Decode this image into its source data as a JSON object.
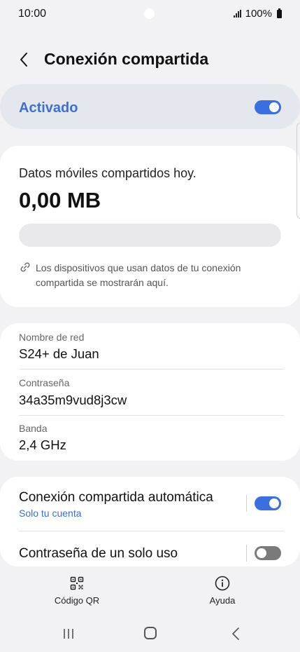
{
  "status_bar": {
    "time": "10:00",
    "battery": "100%"
  },
  "header": {
    "title": "Conexión compartida"
  },
  "master_toggle": {
    "label": "Activado",
    "on": true
  },
  "data_usage": {
    "label": "Datos móviles compartidos hoy.",
    "value": "0,00 MB",
    "fraction": 0.0,
    "devices_note": "Los dispositivos que usan datos de tu conexión compartida se mostrarán aquí."
  },
  "network": {
    "name_label": "Nombre de red",
    "name_value": "S24+ de Juan",
    "password_label": "Contraseña",
    "password_value": "34a35m9vud8j3cw",
    "band_label": "Banda",
    "band_value": "2,4 GHz"
  },
  "auto_hotspot": {
    "title": "Conexión compartida automática",
    "subtitle": "Solo tu cuenta",
    "on": true
  },
  "one_time_password": {
    "title": "Contraseña de un solo uso",
    "on": false
  },
  "bottom_actions": {
    "qr_label": "Código QR",
    "help_label": "Ayuda"
  },
  "colors": {
    "accent": "#3b6fe0",
    "accent_text": "#3e6fd1",
    "background": "#f2f2f4",
    "card": "#ffffff"
  },
  "icons": [
    "back-arrow-icon",
    "link-icon",
    "qr-code-icon",
    "info-icon",
    "recent-apps-icon",
    "home-icon",
    "nav-back-icon"
  ]
}
